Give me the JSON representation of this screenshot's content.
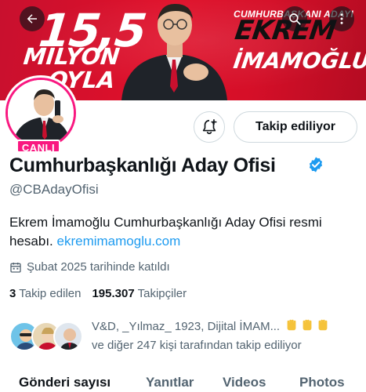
{
  "banner": {
    "big_number": "15,5",
    "line_milyon": "MİLYON",
    "line_oyla": "OYLA",
    "candidate_label": "CUMHURBAŞKANI ADAYI",
    "name_first": "EKREM",
    "name_last": "İMAMOĞLU",
    "colors": {
      "primary": "#d50f28",
      "dark": "#111111"
    }
  },
  "top_nav": {
    "back_icon": "arrow-left-icon",
    "search_icon": "search-icon",
    "more_icon": "more-vertical-icon"
  },
  "avatar": {
    "live_badge": "CANLI",
    "ring_color": "#f91880"
  },
  "actions": {
    "notification_icon": "bell-plus-icon",
    "follow_label": "Takip ediliyor"
  },
  "profile": {
    "display_name": "Cumhurbaşkanlığı Aday Ofisi",
    "verified_icon": "verified-badge-icon",
    "handle": "@CBAdayOfisi",
    "bio_text": "Ekrem İmamoğlu Cumhurbaşkanlığı Aday Ofisi resmi hesabı. ",
    "bio_link": "ekremimamoglu.com",
    "joined_icon": "calendar-icon",
    "joined": "Şubat 2025 tarihinde katıldı",
    "following_count": "3",
    "following_label": "Takip edilen",
    "followers_count": "195.307",
    "followers_label": "Takipçiler"
  },
  "followed_by": {
    "line1": "V&D, _Yılmaz_ 1923, Dijital İMAM...",
    "line2": "ve diğer 247 kişi tarafından takip ediliyor",
    "emoji_icon": "raised-fist-icon"
  },
  "tabs": [
    {
      "label": "Gönderi sayısı"
    },
    {
      "label": "Yanıtlar"
    },
    {
      "label": "Videos"
    },
    {
      "label": "Photos"
    }
  ]
}
